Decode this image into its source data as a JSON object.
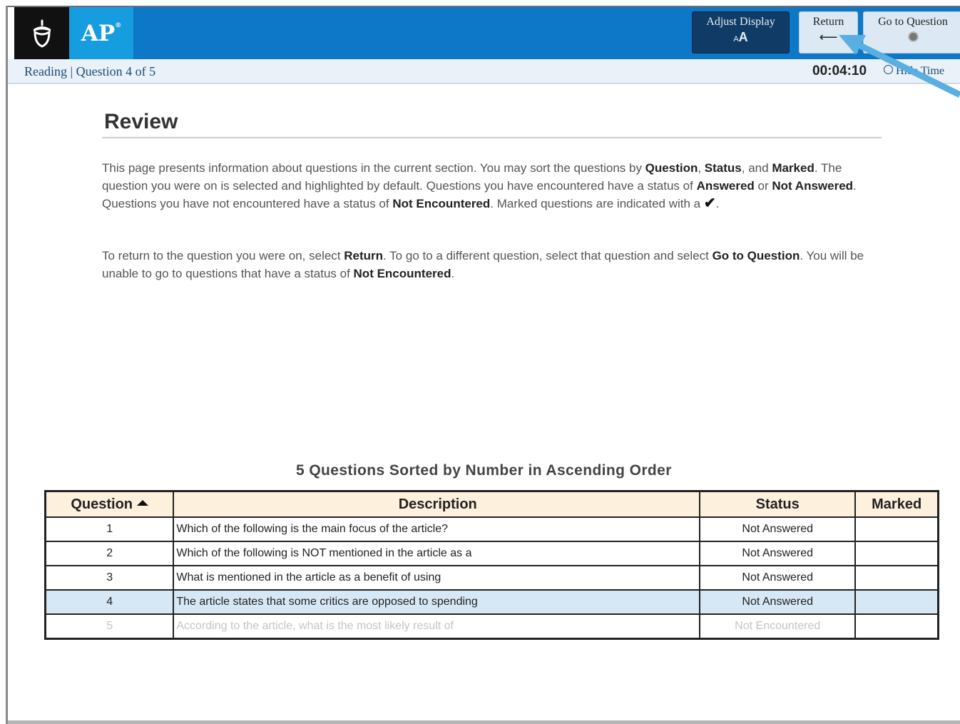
{
  "header": {
    "logo_text": "AP",
    "logo_mark": "®",
    "buttons": {
      "adjust_display": "Adjust Display",
      "adjust_icon": "A",
      "return": "Return",
      "return_icon": "⟵",
      "go_to_question": "Go to Question"
    },
    "colors": {
      "header_blue": "#0d77c8",
      "ap_blue": "#169ddf",
      "adjust_bg": "#0f3b66",
      "button_bg": "#dce9f4"
    }
  },
  "subbar": {
    "breadcrumb": "Reading | Question 4 of 5",
    "timer": "00:04:10",
    "hide_time": "Hide Time"
  },
  "review": {
    "title": "Review",
    "p1": {
      "t1": "This page presents information about questions in the current section. You may sort the questions by ",
      "b1": "Question",
      "t2": ", ",
      "b2": "Status",
      "t3": ", and ",
      "b3": "Marked",
      "t4": ". The question you were on is selected and highlighted by default. Questions you have encountered have a status of ",
      "b4": "Answered",
      "t5": " or ",
      "b5": "Not Answered",
      "t6": ". Questions you have not encountered have a status of ",
      "b6": "Not Encountered",
      "t7": ". Marked questions are indicated with a ",
      "check": "✔",
      "t8": "."
    },
    "p2": {
      "t1": "To return to the question you were on, select ",
      "b1": "Return",
      "t2": ". To go to a different question, select that question and select ",
      "b2": "Go to Question",
      "t3": ". You will be unable to go to questions that have a status of ",
      "b3": "Not Encountered",
      "t4": "."
    }
  },
  "table": {
    "caption": "5 Questions Sorted by Number in Ascending Order",
    "columns": [
      "Question",
      "Description",
      "Status",
      "Marked"
    ],
    "rows": [
      {
        "question": "1",
        "description": "Which of the following is the main focus of the article?",
        "status": "Not Answered",
        "marked": ""
      },
      {
        "question": "2",
        "description": "Which of the following is NOT mentioned in the article as a",
        "status": "Not Answered",
        "marked": ""
      },
      {
        "question": "3",
        "description": "What is mentioned in the article as a benefit of using",
        "status": "Not Answered",
        "marked": ""
      },
      {
        "question": "4",
        "description": "The article states that some critics are opposed to spending",
        "status": "Not Answered",
        "marked": ""
      },
      {
        "question": "5",
        "description": "According to the article, what is the most likely result of",
        "status": "Not Encountered",
        "marked": ""
      }
    ],
    "selected_row": "4"
  }
}
